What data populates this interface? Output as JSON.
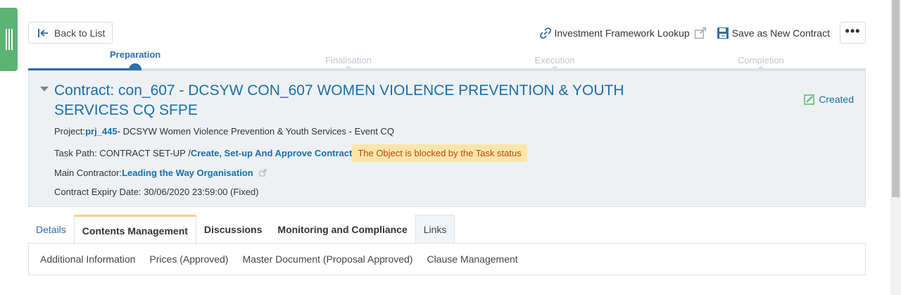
{
  "toolbar": {
    "back_label": "Back to List",
    "investment_lookup_label": "Investment Framework Lookup",
    "save_new_contract_label": "Save as New Contract",
    "more_label": "•••"
  },
  "stepper": {
    "steps": [
      {
        "label": "Preparation",
        "state": "active"
      },
      {
        "label": "Finalisation",
        "state": "inactive"
      },
      {
        "label": "Execution",
        "state": "inactive"
      },
      {
        "label": "Completion",
        "state": "inactive"
      }
    ]
  },
  "contract": {
    "title_line1": "Contract: con_607 - DCSYW CON_607 WOMEN VIOLENCE PREVENTION & YOUTH",
    "title_line2": "SERVICES CQ SFPE",
    "status": "Created",
    "project_label": "Project:",
    "project_id": "prj_445",
    "project_name": "- DCSYW Women Violence Prevention & Youth Services - Event CQ",
    "task_path_label": "Task Path: CONTRACT SET-UP /",
    "task_path_link": "Create, Set-up And Approve Contract",
    "blocked_message": "The Object is blocked by the Task status",
    "main_contractor_label": "Main Contractor:",
    "main_contractor_name": "Leading the Way Organisation",
    "expiry_label": "Contract Expiry Date: 30/06/2020 23:59:00 (Fixed)"
  },
  "tabs": [
    {
      "label": "Details"
    },
    {
      "label": "Contents Management"
    },
    {
      "label": "Discussions"
    },
    {
      "label": "Monitoring and Compliance"
    },
    {
      "label": "Links"
    }
  ],
  "subtabs": [
    {
      "label": "Additional Information"
    },
    {
      "label": "Prices (Approved)"
    },
    {
      "label": "Master Document (Proposal Approved)"
    },
    {
      "label": "Clause Management"
    }
  ],
  "colors": {
    "accent": "#1a6fa8",
    "side_handle": "#5cb474",
    "warning_bg": "#fbe5a8",
    "warning_text": "#b24b12",
    "tab_highlight": "#f7d27a"
  }
}
